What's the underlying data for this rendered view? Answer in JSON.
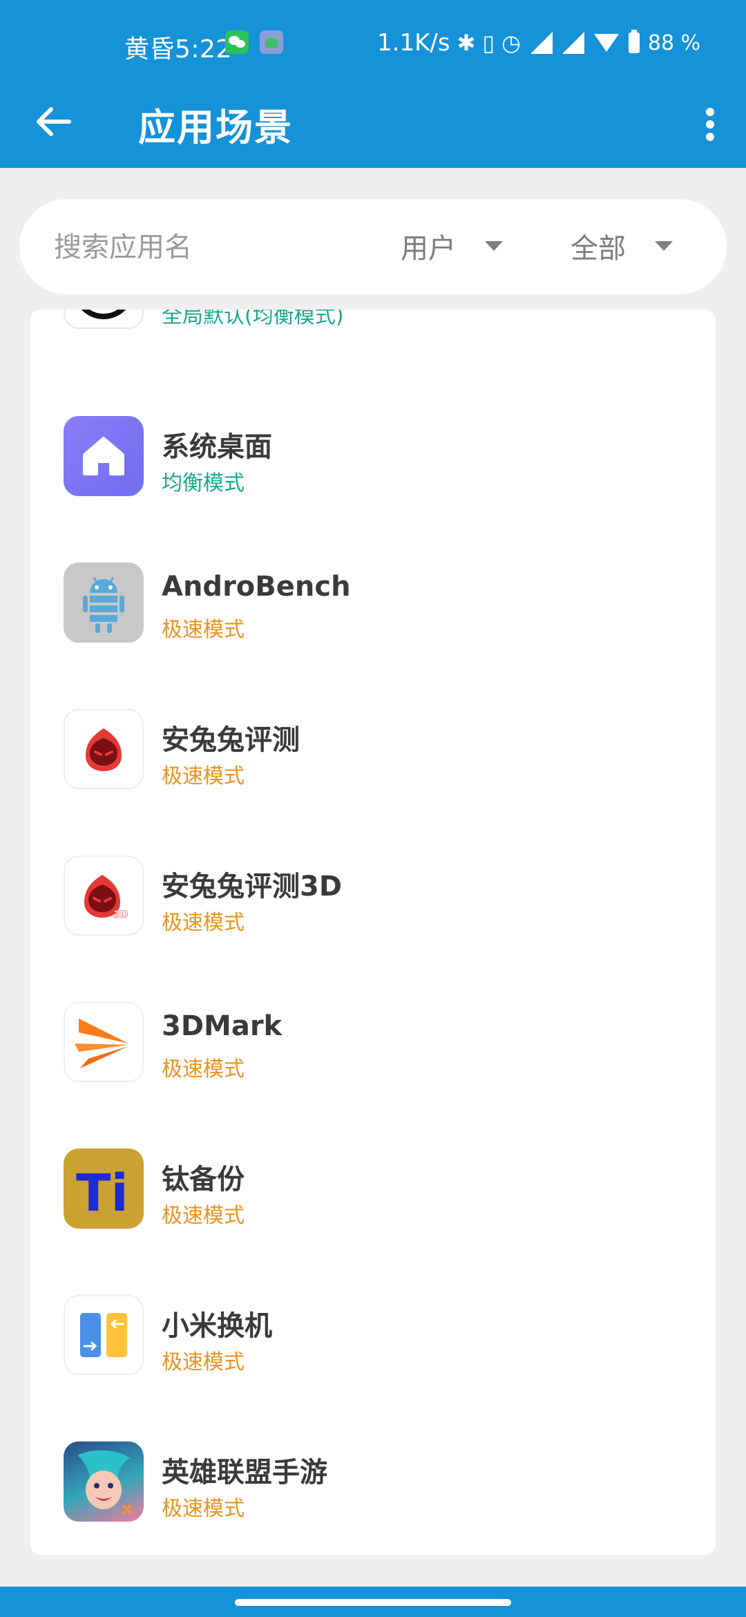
{
  "status_bar": {
    "time": "黄昏5:22",
    "net_speed": "1.1K/s",
    "battery": "88 %",
    "icons": [
      "wechat-icon",
      "robot-app-icon",
      "bluetooth-icon",
      "vibrate-icon",
      "alarm-icon",
      "hd-signal-icon",
      "signal-icon",
      "wifi-icon",
      "battery-icon"
    ]
  },
  "app_bar": {
    "title": "应用场景",
    "back_icon": "arrow-left-icon",
    "menu_icon": "more-vert-icon"
  },
  "filter": {
    "search_placeholder": "搜索应用名",
    "user_label": "用户",
    "all_label": "全部"
  },
  "apps": [
    {
      "name": "",
      "mode": "全局默认(均衡模式)",
      "mode_color": "#19a88a",
      "icon": "no-sign-app-icon"
    },
    {
      "name": "系统桌面",
      "mode": "均衡模式",
      "mode_color": "#19a88a",
      "icon": "home-app-icon"
    },
    {
      "name": "AndroBench",
      "mode": "极速模式",
      "mode_color": "#e9931e",
      "icon": "android-bench-app-icon"
    },
    {
      "name": "安兔兔评测",
      "mode": "极速模式",
      "mode_color": "#e9931e",
      "icon": "antutu-app-icon"
    },
    {
      "name": "安兔兔评测3D",
      "mode": "极速模式",
      "mode_color": "#e9931e",
      "icon": "antutu-3d-app-icon"
    },
    {
      "name": "3DMark",
      "mode": "极速模式",
      "mode_color": "#e9931e",
      "icon": "3dmark-app-icon"
    },
    {
      "name": "钛备份",
      "mode": "极速模式",
      "mode_color": "#e9931e",
      "icon": "titanium-backup-app-icon"
    },
    {
      "name": "小米换机",
      "mode": "极速模式",
      "mode_color": "#e9931e",
      "icon": "mi-mover-app-icon"
    },
    {
      "name": "英雄联盟手游",
      "mode": "极速模式",
      "mode_color": "#e9931e",
      "icon": "league-of-legends-app-icon"
    }
  ],
  "colors": {
    "primary": "#1692d8",
    "balanced": "#19a88a",
    "turbo": "#e9931e"
  },
  "text_3d": "3D",
  "text_ti": "Ti"
}
